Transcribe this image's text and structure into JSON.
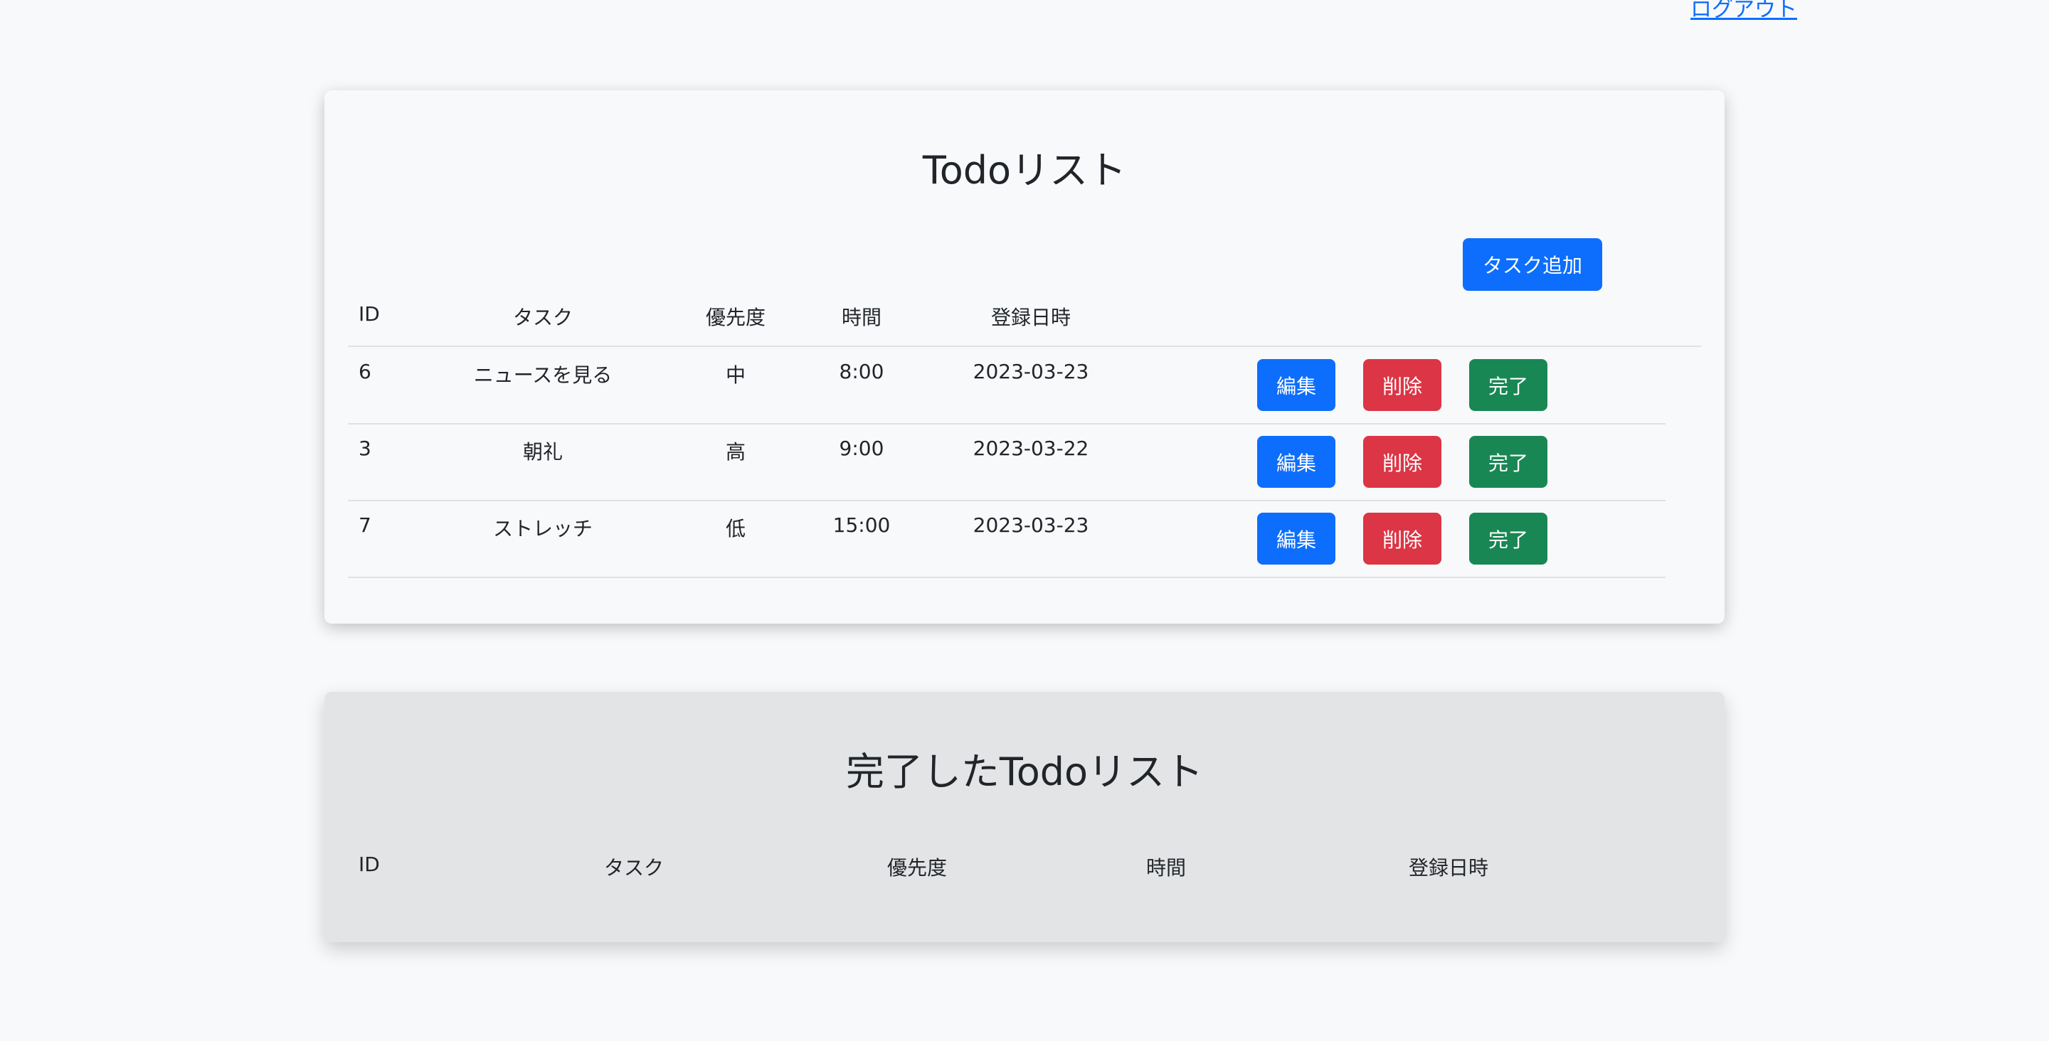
{
  "header": {
    "logout_label": "ログアウト"
  },
  "active": {
    "title": "Todoリスト",
    "add_button_label": "タスク追加",
    "columns": [
      "ID",
      "タスク",
      "優先度",
      "時間",
      "登録日時"
    ],
    "rows": [
      {
        "id": "6",
        "task": "ニュースを見る",
        "priority": "中",
        "time": "8:00",
        "date": "2023-03-23"
      },
      {
        "id": "3",
        "task": "朝礼",
        "priority": "高",
        "time": "9:00",
        "date": "2023-03-22"
      },
      {
        "id": "7",
        "task": "ストレッチ",
        "priority": "低",
        "time": "15:00",
        "date": "2023-03-23"
      }
    ],
    "actions": {
      "edit_label": "編集",
      "delete_label": "削除",
      "complete_label": "完了"
    }
  },
  "completed": {
    "title": "完了したTodoリスト",
    "columns": [
      "ID",
      "タスク",
      "優先度",
      "時間",
      "登録日時"
    ]
  },
  "colors": {
    "primary": "#0d6efd",
    "danger": "#dc3545",
    "success": "#198754",
    "page_background": "#f8f9fb",
    "completed_card_background": "#e3e4e6"
  }
}
